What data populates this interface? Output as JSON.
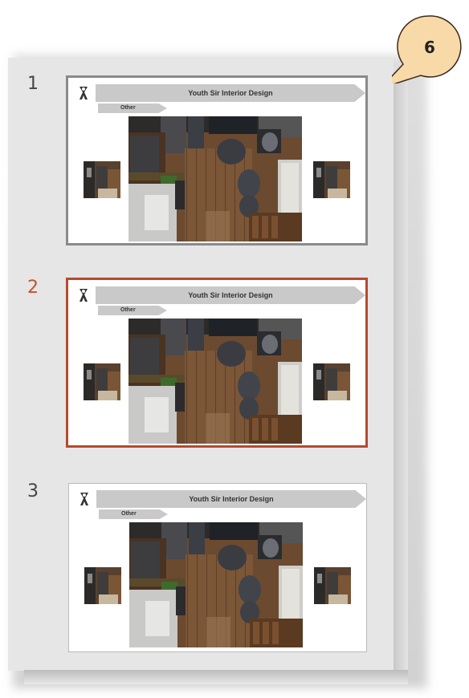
{
  "slides": [
    {
      "number": "1",
      "title": "Youth Sir Interior Design",
      "tag": "Other",
      "state": "hover"
    },
    {
      "number": "2",
      "title": "Youth Sir Interior Design",
      "tag": "Other",
      "state": "selected"
    },
    {
      "number": "3",
      "title": "Youth Sir Interior Design",
      "tag": "Other",
      "state": "normal"
    }
  ],
  "callout": {
    "label": "6",
    "fill": "#f8d9a8",
    "stroke": "#3a2a1a"
  },
  "colors": {
    "selected": "#c8502d",
    "hover_border": "#8a8a8a",
    "panel": "#e6e6e6"
  },
  "icons": {
    "logo": "ribbon-logo-icon"
  }
}
